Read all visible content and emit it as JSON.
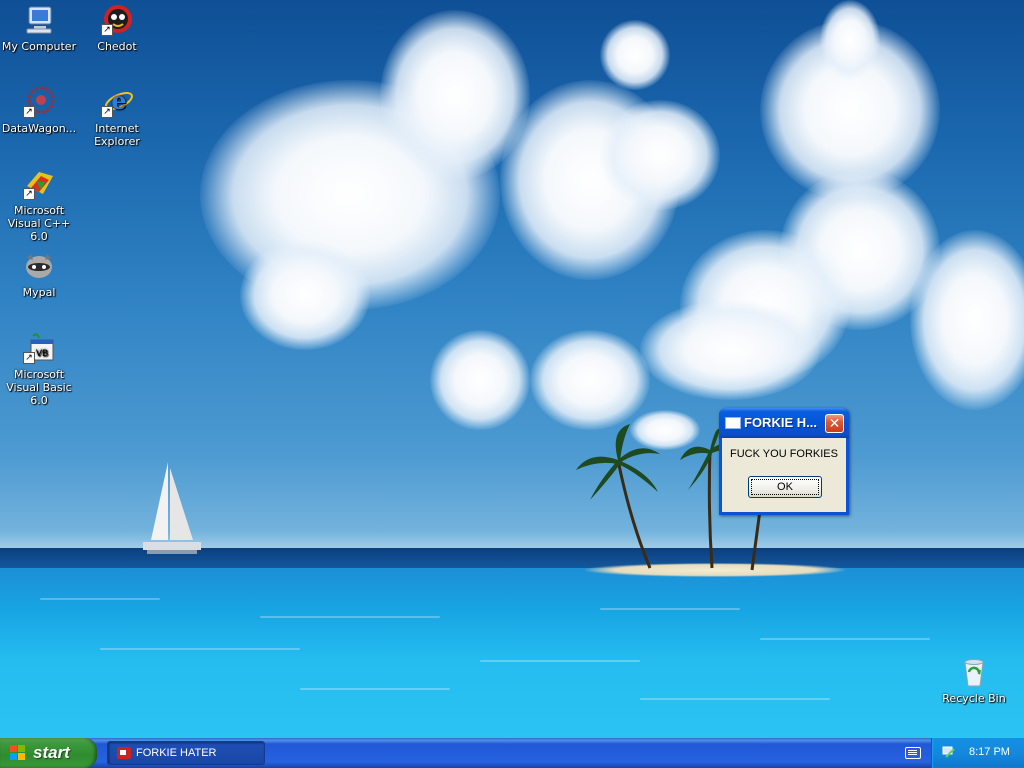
{
  "desktop": {
    "icons": [
      {
        "label": "My Computer",
        "icon": "my-computer-icon"
      },
      {
        "label": "Chedot",
        "icon": "chedot-icon"
      },
      {
        "label": "DataWagon...",
        "icon": "datawagon-icon"
      },
      {
        "label": "Internet Explorer",
        "icon": "internet-explorer-icon"
      },
      {
        "label": "Microsoft Visual C++ 6.0",
        "icon": "visual-cpp-icon"
      },
      {
        "label": "Mypal",
        "icon": "mypal-icon"
      },
      {
        "label": "Microsoft Visual Basic 6.0",
        "icon": "visual-basic-icon"
      },
      {
        "label": "Recycle Bin",
        "icon": "recycle-bin-icon"
      }
    ]
  },
  "dialog": {
    "title": "FORKIE H...",
    "message": "FUCK YOU FORKIES",
    "ok_label": "OK",
    "close_glyph": "✕"
  },
  "taskbar": {
    "start_label": "start",
    "tasks": [
      {
        "label": "FORKIE HATER",
        "icon": "app-icon"
      }
    ],
    "clock": "8:17 PM"
  },
  "colors": {
    "taskbar_blue": "#2663e0",
    "start_green": "#3c9b3c",
    "dialog_title_blue": "#0654d6",
    "close_red": "#dc5a37",
    "dialog_face": "#ece9d8"
  }
}
